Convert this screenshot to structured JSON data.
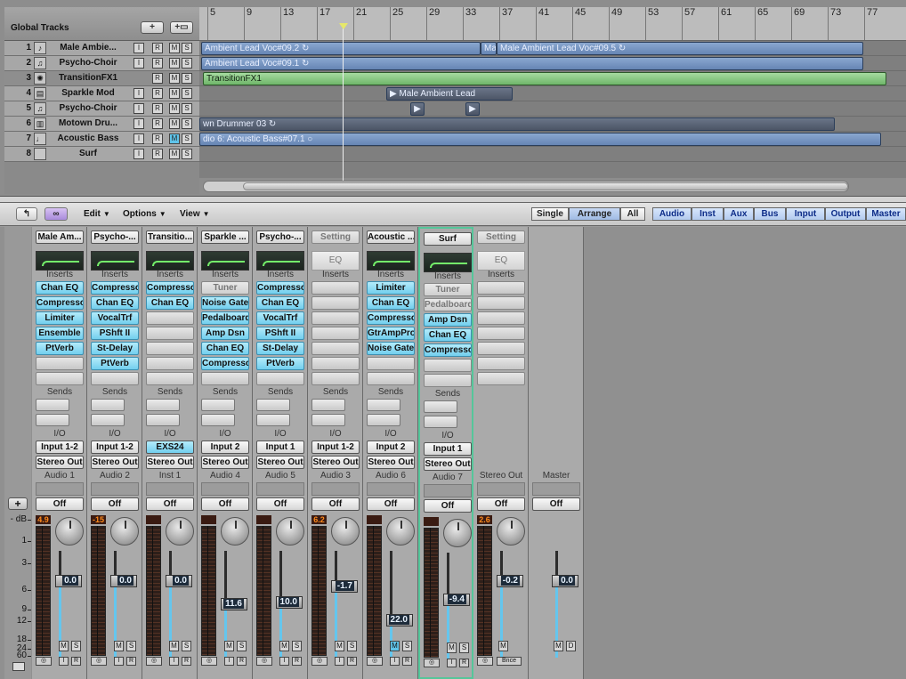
{
  "arrange": {
    "global_tracks_label": "Global Tracks",
    "add_track_button": "+",
    "add_folder_button": "+▭",
    "ruler_bars": [
      "5",
      "9",
      "13",
      "17",
      "21",
      "25",
      "29",
      "33",
      "37",
      "41",
      "45",
      "49",
      "53",
      "57",
      "61",
      "65",
      "69",
      "73",
      "77"
    ],
    "tracks": [
      {
        "num": "1",
        "name": "Male Ambie...",
        "icon": "vocal-icon",
        "buttons": [
          "I",
          "R",
          "M",
          "S"
        ],
        "m_on": false
      },
      {
        "num": "2",
        "name": "Psycho-Choir",
        "icon": "choir-icon",
        "buttons": [
          "I",
          "R",
          "M",
          "S"
        ],
        "m_on": false
      },
      {
        "num": "3",
        "name": "TransitionFX1",
        "icon": "fx-icon",
        "buttons": [
          "R",
          "M",
          "S"
        ],
        "m_on": false
      },
      {
        "num": "4",
        "name": "Sparkle Mod",
        "icon": "synth-icon",
        "buttons": [
          "I",
          "R",
          "M",
          "S"
        ],
        "m_on": false
      },
      {
        "num": "5",
        "name": "Psycho-Choir",
        "icon": "choir-icon",
        "buttons": [
          "I",
          "R",
          "M",
          "S"
        ],
        "m_on": false
      },
      {
        "num": "6",
        "name": "Motown Dru...",
        "icon": "drum-icon",
        "buttons": [
          "I",
          "R",
          "M",
          "S"
        ],
        "m_on": false
      },
      {
        "num": "7",
        "name": "Acoustic Bass",
        "icon": "bass-icon",
        "buttons": [
          "I",
          "R",
          "M",
          "S"
        ],
        "m_on": true
      },
      {
        "num": "8",
        "name": "Surf",
        "icon": "blank-icon",
        "buttons": [
          "I",
          "R",
          "M",
          "S"
        ],
        "m_on": false
      }
    ],
    "regions": {
      "r1a": "Ambient Lead Voc#09.2 ↻",
      "r1b": "Ma",
      "r1c": "Male Ambient Lead Voc#09.5 ↻",
      "r2": "Ambient Lead Voc#09.1 ↻",
      "r3": "TransitionFX1",
      "r4": "▶ Male Ambient Lead",
      "r6": "wn Drummer 03 ↻",
      "r7": "dio 6: Acoustic Bass#07.1 ○"
    }
  },
  "toolbar": {
    "edit": "Edit",
    "options": "Options",
    "view": "View",
    "single": "Single",
    "arrange": "Arrange",
    "all": "All",
    "audio": "Audio",
    "inst": "Inst",
    "aux": "Aux",
    "bus": "Bus",
    "input": "Input",
    "output": "Output",
    "master": "Master"
  },
  "mixer": {
    "db_labels": [
      "- dB",
      "1",
      "3",
      "6",
      "9",
      "12",
      "18",
      "24",
      "60"
    ],
    "labels": {
      "inserts": "Inserts",
      "sends": "Sends",
      "io": "I/O",
      "eq": "EQ",
      "off": "Off"
    },
    "strips": [
      {
        "name": "Male Am...",
        "eq": true,
        "inserts": [
          "Chan EQ",
          "Compresso",
          "Limiter",
          "Ensemble",
          "PtVerb"
        ],
        "input": "Input 1-2",
        "output": "Stereo Out",
        "type": "Audio 1",
        "peak": "4.9",
        "fader": "0.0",
        "fader_level": 0.72,
        "sel": false
      },
      {
        "name": "Psycho-...",
        "eq": true,
        "inserts": [
          "Compresso",
          "Chan EQ",
          "VocalTrf",
          "PShft II",
          "St-Delay",
          "PtVerb"
        ],
        "input": "Input 1-2",
        "output": "Stereo Out",
        "type": "Audio 2",
        "peak": "-15",
        "fader": "0.0",
        "fader_level": 0.72,
        "sel": false
      },
      {
        "name": "Transitio...",
        "eq": true,
        "inserts": [
          "Compresso",
          "Chan EQ"
        ],
        "input": "EXS24",
        "output": "Stereo Out",
        "type": "Inst 1",
        "peak": "",
        "fader": "0.0",
        "fader_level": 0.72,
        "sel": false,
        "input_hl": true
      },
      {
        "name": "Sparkle ...",
        "eq": true,
        "inserts": [
          "Tuner",
          "Noise Gate",
          "Pedalboard",
          "Amp Dsn",
          "Chan EQ",
          "Compresso"
        ],
        "input": "Input 2",
        "output": "Stereo Out",
        "type": "Audio 4",
        "peak": "",
        "fader": "11.6",
        "fader_level": 0.5,
        "sel": false,
        "tuner_grey": true
      },
      {
        "name": "Psycho-...",
        "eq": true,
        "inserts": [
          "Compresso",
          "Chan EQ",
          "VocalTrf",
          "PShft II",
          "St-Delay",
          "PtVerb"
        ],
        "input": "Input 1",
        "output": "Stereo Out",
        "type": "Audio 5",
        "peak": "",
        "fader": "10.0",
        "fader_level": 0.52,
        "sel": false
      },
      {
        "name": "Setting",
        "eq": false,
        "inserts": [],
        "input": "Input 1-2",
        "output": "Stereo Out",
        "type": "Audio 3",
        "peak": "6.2",
        "fader": "-1.7",
        "fader_level": 0.67,
        "sel": false,
        "name_grey": true
      },
      {
        "name": "Acoustic ...",
        "eq": true,
        "inserts": [
          "Limiter",
          "Chan EQ",
          "Compresso",
          "GtrAmpPro",
          "Noise Gate"
        ],
        "input": "Input 2",
        "output": "Stereo Out",
        "type": "Audio 6",
        "peak": "",
        "fader": "22.0",
        "fader_level": 0.35,
        "sel": false,
        "m_on": true
      },
      {
        "name": "Surf",
        "eq": true,
        "inserts": [
          "Tuner",
          "Pedalboard",
          "Amp Dsn",
          "Chan EQ",
          "Compresso"
        ],
        "input": "Input 1",
        "output": "Stereo Out",
        "type": "Audio 7",
        "peak": "",
        "fader": "-9.4",
        "fader_level": 0.56,
        "sel": true,
        "tuner_grey": true
      },
      {
        "name": "Setting",
        "eq": false,
        "inserts": [],
        "output_label": "Stereo Out",
        "peak": "2.6",
        "fader": "-0.2",
        "fader_level": 0.72,
        "sel": false,
        "is_out": true,
        "name_grey": true
      },
      {
        "name": "",
        "eq": false,
        "output_label": "Master",
        "fader": "0.0",
        "fader_level": 0.72,
        "is_master": true
      }
    ]
  },
  "colors": {
    "plugin": "#72cfee",
    "region_blue": "#6685b4",
    "region_green": "#6fb66a",
    "selected_strip": "#55c69a"
  }
}
